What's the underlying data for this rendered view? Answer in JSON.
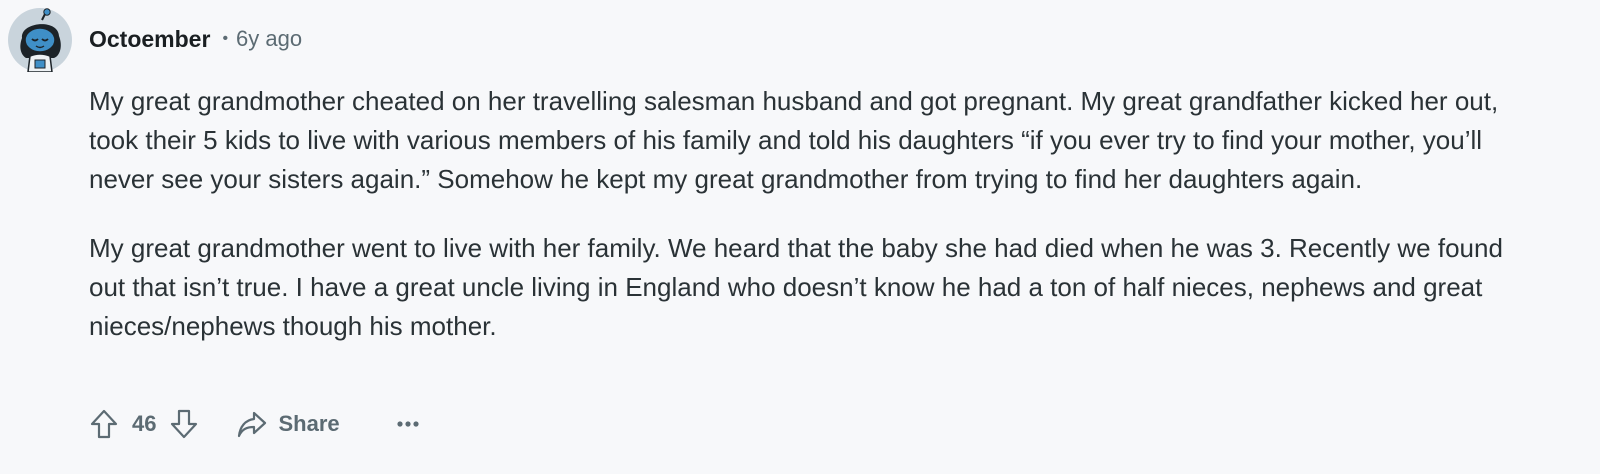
{
  "comment": {
    "author": "Octoember",
    "separator": "•",
    "time": "6y ago",
    "paragraphs": [
      "My great grandmother cheated on her travelling salesman husband and got pregnant. My great grandfather kicked her out, took their 5 kids to live with various members of his family and told his daughters “if you ever try to find your mother, you’ll never see your sisters again.” Somehow he kept my great grandmother from trying to find her daughters again.",
      "My great grandmother went to live with her family. We heard that the baby she had died when he was 3. Recently we found out that isn’t true. I have a great uncle living in England who doesn’t know he had a ton of half nieces, nephews and great nieces/nephews though his mother."
    ]
  },
  "actions": {
    "score": "46",
    "share_label": "Share",
    "upvote_icon": "upvote-arrow-icon",
    "downvote_icon": "downvote-arrow-icon",
    "share_icon": "share-arrow-icon",
    "more_icon": "ellipsis-icon"
  },
  "colors": {
    "background": "#f7f8fa",
    "text": "#2a3236",
    "muted": "#5c6b73",
    "avatar_bg": "#c9d4dc",
    "avatar_body": "#3f8fc7"
  }
}
